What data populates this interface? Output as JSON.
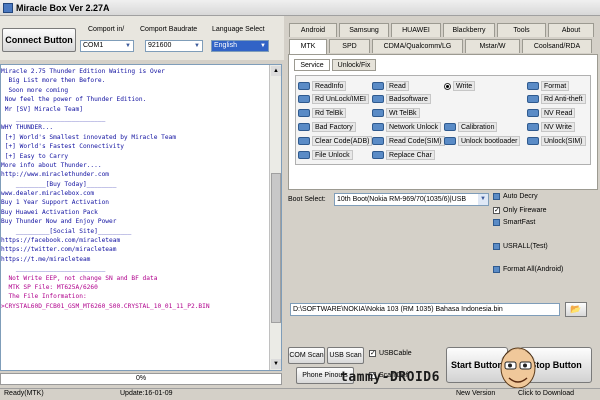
{
  "window": {
    "title": "Miracle Box Ver 2.27A"
  },
  "connection": {
    "connect_label": "Connect Button",
    "comport_label": "Comport in/",
    "comport_value": "COM1",
    "baud_label": "Comport Baudrate",
    "baud_value": "921600",
    "language_label": "Language Select",
    "language_value": "English"
  },
  "log_lines": [
    "Miracle 2.75 Thunder Edition Waiting is Over",
    "  Big List more then Before.",
    "  Soon more coming",
    " Now feel the power of Thunder Edition.",
    " Mr [SV] Miracle Team]",
    "    ________________________",
    "WHY THUNDER...",
    " [+] World's Smallest innovated by Miracle Team",
    " [+] World's Fastest Connectivity",
    " [+] Easy to Carry",
    "More info about Thunder....",
    "http://www.miraclethunder.com",
    "    ________[Buy Today]________",
    "www.dealer.miraclebox.com",
    "Buy 1 Year Support Activation",
    "Buy Huawei Activation Pack",
    "Buy Thunder Now and Enjoy Power",
    "    _________[Social Site]_________",
    "https://facebook.com/miracleteam",
    "https://twitter.com/miracleteam",
    "https://t.me/miracleteam",
    "    ________________________",
    "  Not Write EEP, not change SN and BF data",
    "  MTK SP File: MT625A/6260",
    "  The File Information:",
    ">CRYSTAL60D_FCB01_GSM_MT6260_S00.CRYSTAL_10_01_11_P2.BIN"
  ],
  "progress": {
    "value": 0,
    "label": "0%"
  },
  "tabs_row1": [
    "Android",
    "Samsung",
    "HUAWEI",
    "Blackberry",
    "Tools",
    "About"
  ],
  "tabs_row2": [
    "MTK",
    "SPD",
    "CDMA/Qualcomm/LG",
    "Mstar/W",
    "Coolsand/RDA"
  ],
  "active_tab": "MTK",
  "subtabs": [
    "Service",
    "Unlock/Fix"
  ],
  "options": {
    "col1": [
      "ReadInfo",
      "Rd UnLock/IMEI",
      "Rd TelBk",
      "Bad Factory",
      "Clear Code(ADB)",
      "File Unlock"
    ],
    "col2": [
      "Read",
      "Badsoftware",
      "Wt TelBk",
      "Network Unlock",
      "Read Code(SIM)",
      "Replace Char"
    ],
    "col3": [
      "Write",
      "Calibration",
      "Unlock bootloader"
    ],
    "col4": [
      "Format",
      "Rd Anti-theft",
      "NV Read",
      "NV Write",
      "Unlock(SIM)"
    ]
  },
  "boot": {
    "label": "Boot Select:",
    "value": "10th Boot(Nokia RM-969/70(1035/6)|USB",
    "auto_decry": "Auto Decry",
    "only_firmware": "Only Fireware",
    "smartfast": "SmartFast",
    "usrall": "USRALL(Test)",
    "format_all": "Format All(Android)"
  },
  "file_path": "D:\\SOFTWARE\\NOKIA\\Nokia 103 (RM 1035) Bahasa Indonesia.bin",
  "bottom": {
    "com_scan": "COM Scan",
    "usb_scan": "USB Scan",
    "usb_cable": "USBCable",
    "phone_pinouts": "Phone Pinouts",
    "scan_def": "Scan Def",
    "start": "Start Button",
    "stop": "Stop Button"
  },
  "status": {
    "ready": "Ready(MTK)",
    "update": "Update:16-01-09",
    "new_version": "New Version",
    "download": "Click to Download"
  },
  "watermark": "tammy-DROID6"
}
